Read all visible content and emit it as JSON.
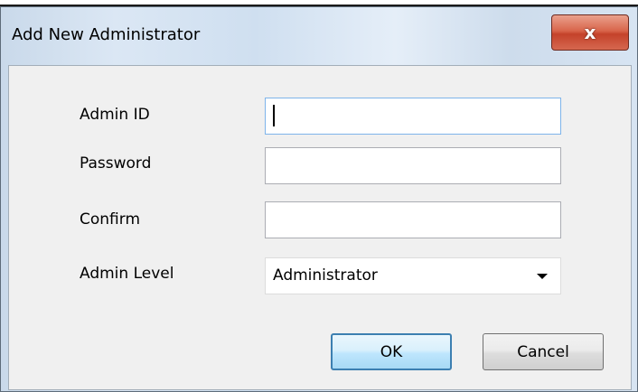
{
  "window": {
    "title": "Add New Administrator",
    "close_glyph": "x"
  },
  "form": {
    "admin_id_label": "Admin ID",
    "admin_id_value": "",
    "password_label": "Password",
    "password_value": "",
    "confirm_label": "Confirm",
    "confirm_value": "",
    "admin_level_label": "Admin Level",
    "admin_level_value": "Administrator"
  },
  "buttons": {
    "ok_label": "OK",
    "cancel_label": "Cancel"
  },
  "colors": {
    "close_button": "#c4422a",
    "ok_border": "#3c7fb1",
    "client_bg": "#f0f0f0"
  },
  "icons": {
    "close": "close-icon",
    "dropdown": "chevron-down-icon"
  }
}
